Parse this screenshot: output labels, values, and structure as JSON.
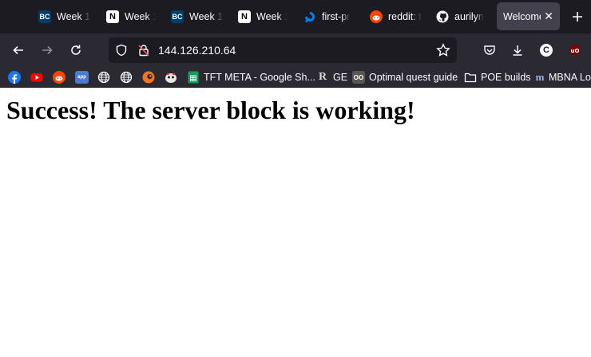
{
  "tabs": [
    {
      "label": "Week 1",
      "icon": "bcit-icon"
    },
    {
      "label": "Week 1",
      "icon": "notion-icon"
    },
    {
      "label": "Week 1",
      "icon": "bcit-icon"
    },
    {
      "label": "Week 1",
      "icon": "notion-icon"
    },
    {
      "label": "first-pr",
      "icon": "digitalocean-icon"
    },
    {
      "label": "reddit: t",
      "icon": "reddit-icon"
    },
    {
      "label": "aurilyn",
      "icon": "github-icon"
    },
    {
      "label": "Welcome",
      "icon": "",
      "active": true
    }
  ],
  "navbar": {
    "url": "144.126.210.64"
  },
  "bookmarks": [
    {
      "label": "",
      "icon": "facebook-icon"
    },
    {
      "label": "",
      "icon": "youtube-icon"
    },
    {
      "label": "",
      "icon": "reddit-icon"
    },
    {
      "label": "",
      "icon": "app-icon"
    },
    {
      "label": "",
      "icon": "globe-icon"
    },
    {
      "label": "",
      "icon": "globe-icon"
    },
    {
      "label": "",
      "icon": "crunchyroll-icon"
    },
    {
      "label": "",
      "icon": "mascot-icon"
    },
    {
      "label": "TFT META - Google Sh...",
      "icon": "google-sheets-icon"
    },
    {
      "label": "GE",
      "icon": "runescape-icon"
    },
    {
      "label": "Optimal quest guide",
      "icon": "quest-icon"
    },
    {
      "label": "POE builds",
      "icon": "folder-icon"
    },
    {
      "label": "MBNA Lo",
      "icon": "mbna-icon"
    }
  ],
  "page": {
    "heading": "Success!  The server block is working!"
  },
  "colors": {
    "tabstrip": "#1c1b22",
    "toolbar": "#2b2a33",
    "urlbar": "#1c1b22",
    "active_tab": "#42414d",
    "text": "#fbfbfe"
  }
}
